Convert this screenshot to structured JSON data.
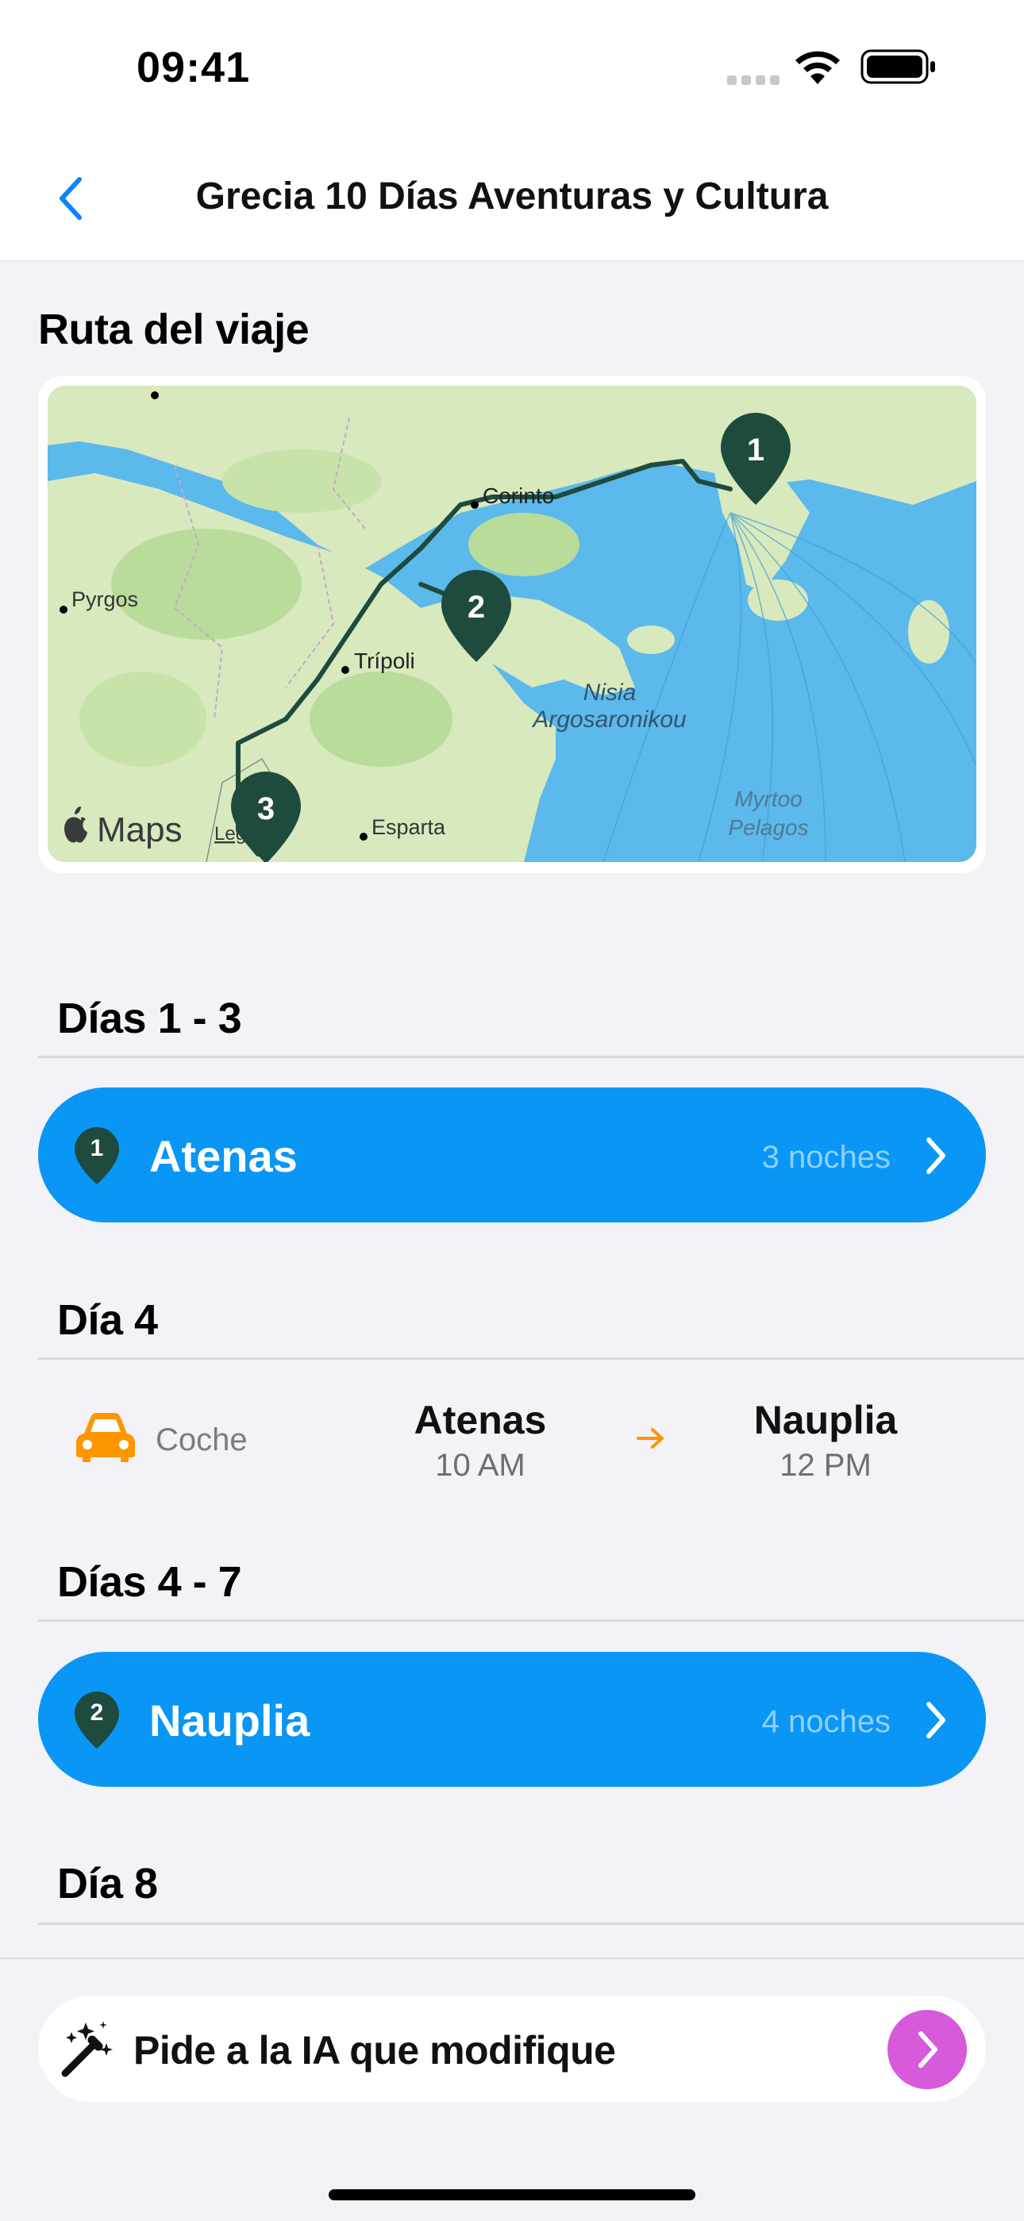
{
  "status_bar": {
    "time": "09:41"
  },
  "nav": {
    "title": "Grecia 10 Días Aventuras y Cultura"
  },
  "route_section": {
    "title": "Ruta del viaje"
  },
  "map": {
    "labels": {
      "corinto": "Corinto",
      "pyrgos": "Pyrgos",
      "tripoli": "Trípoli",
      "esparta": "Esparta",
      "nisia_1": "Nisia",
      "nisia_2": "Argosaronikou",
      "myrtoo_1": "Myrtoo",
      "myrtoo_2": "Pelagos"
    },
    "markers": [
      "1",
      "2",
      "3"
    ],
    "brand": "Maps",
    "legal": "Legal",
    "colors": {
      "land": "#DCEBC2",
      "water": "#5BB9EC",
      "route": "#1F4A3E",
      "marker": "#1F4A3E"
    }
  },
  "itinerary": {
    "sections": [
      {
        "header": "Días 1 - 3"
      },
      {
        "header": "Día 4"
      },
      {
        "header": "Días 4 - 7"
      },
      {
        "header": "Día 8"
      }
    ],
    "stays": [
      {
        "number": "1",
        "city": "Atenas",
        "nights": "3 noches"
      },
      {
        "number": "2",
        "city": "Nauplia",
        "nights": "4 noches"
      }
    ],
    "transport": {
      "mode": "Coche",
      "from": {
        "place": "Atenas",
        "time": "10 AM"
      },
      "to": {
        "place": "Nauplia",
        "time": "12 PM"
      }
    }
  },
  "ai_prompt": {
    "placeholder": "Pide a la IA que modifique"
  },
  "colors": {
    "accent_blue": "#0A96F5",
    "ai_purple": "#D65AD9",
    "car_orange": "#FF9500"
  }
}
